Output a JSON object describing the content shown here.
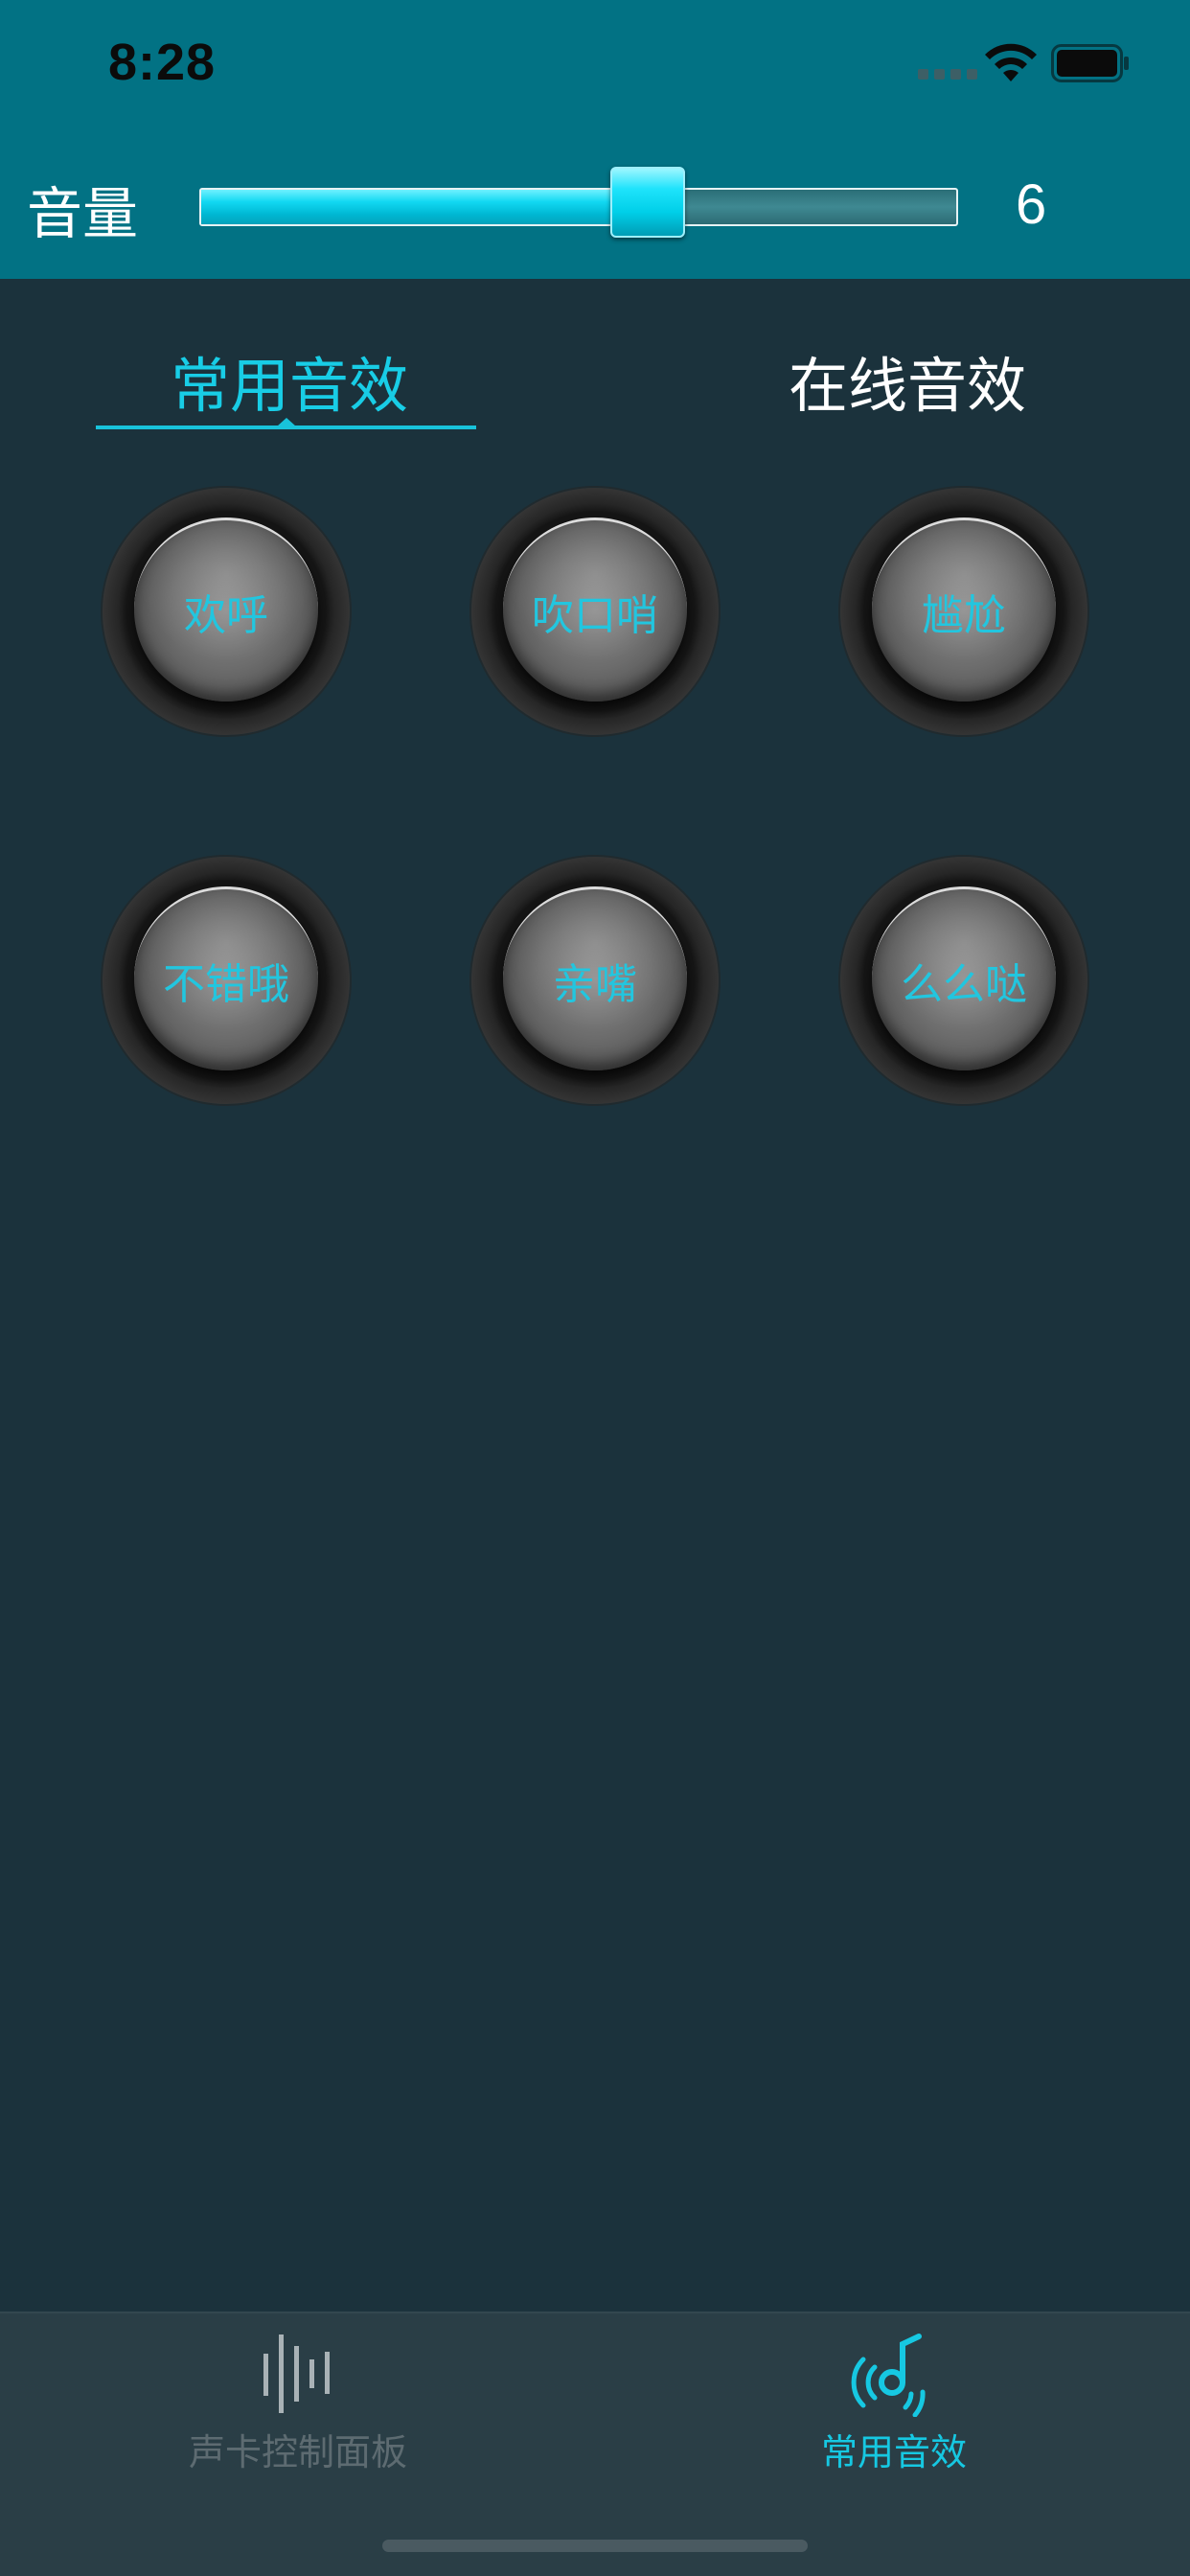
{
  "status_bar": {
    "time": "8:28"
  },
  "volume": {
    "label": "音量",
    "value": "6",
    "level_fraction": 0.592
  },
  "tabs": [
    {
      "label": "常用音效",
      "active": true
    },
    {
      "label": "在线音效",
      "active": false
    }
  ],
  "sound_effects": [
    {
      "label": "欢呼"
    },
    {
      "label": "吹口哨"
    },
    {
      "label": "尴尬"
    },
    {
      "label": "不错哦"
    },
    {
      "label": "亲嘴"
    },
    {
      "label": "么么哒"
    }
  ],
  "tab_bar": {
    "items": [
      {
        "label": "声卡控制面板",
        "icon": "sound-bars-icon",
        "active": false
      },
      {
        "label": "常用音效",
        "icon": "music-note-waves-icon",
        "active": true
      }
    ]
  },
  "colors": {
    "accent": "#18cde6",
    "header_bg": "#027284",
    "page_bg": "#1b323c"
  }
}
